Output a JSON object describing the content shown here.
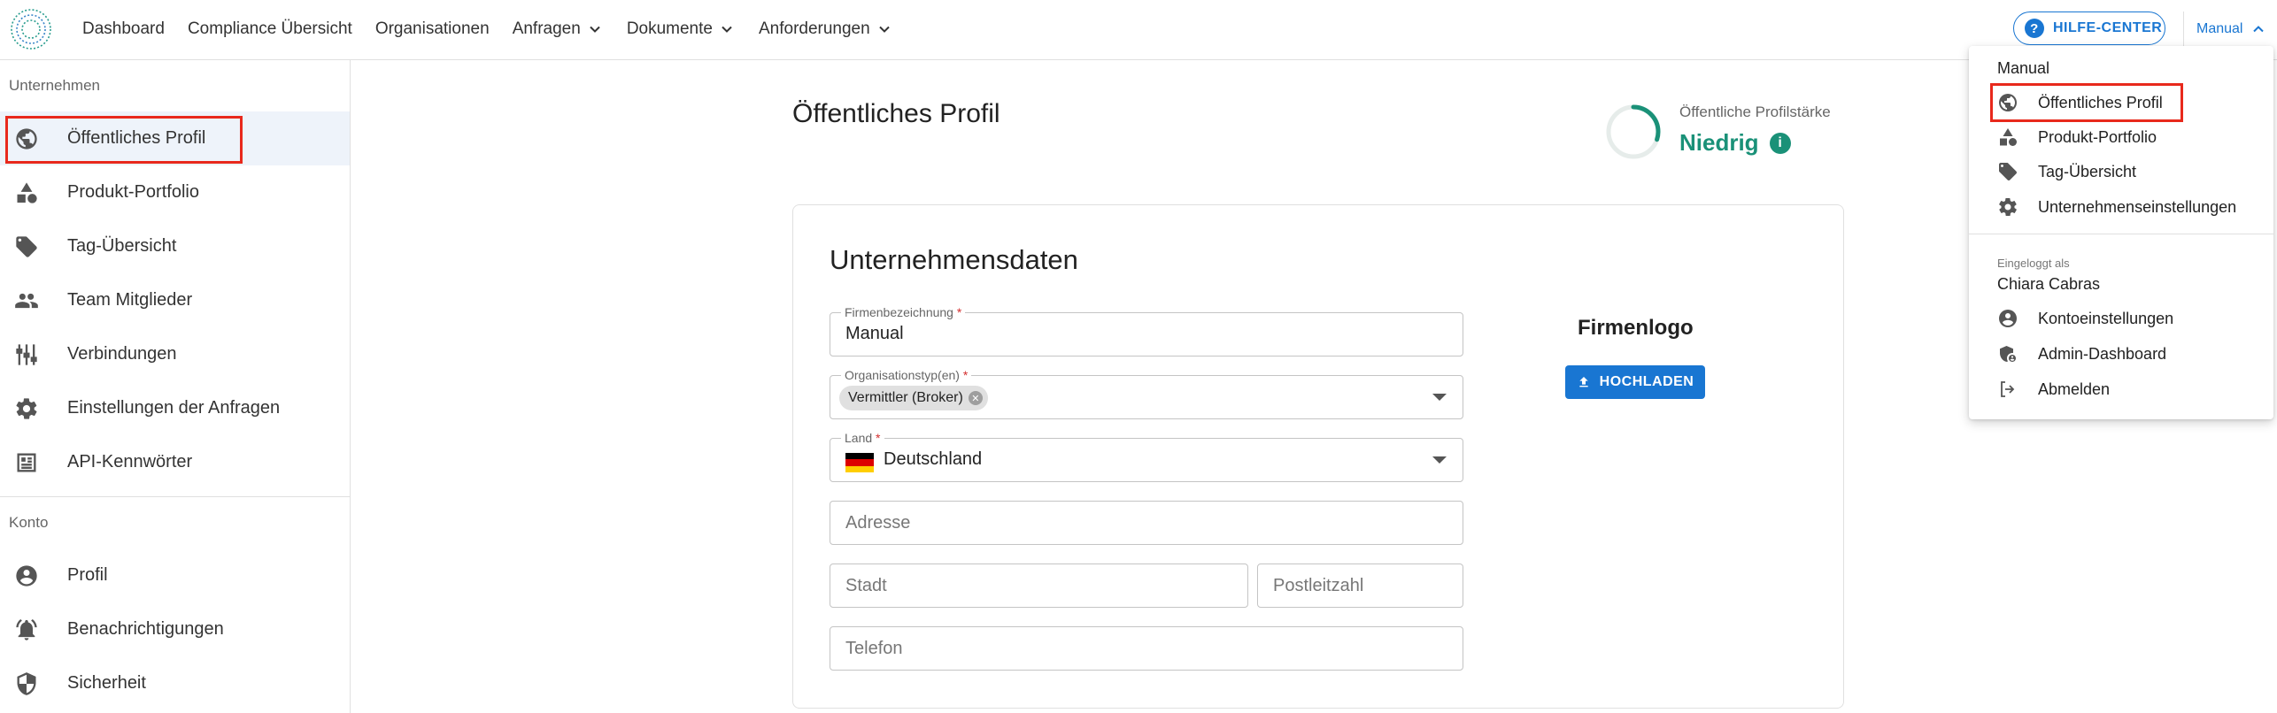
{
  "topnav": {
    "items": [
      {
        "label": "Dashboard",
        "has_chevron": false
      },
      {
        "label": "Compliance Übersicht",
        "has_chevron": false
      },
      {
        "label": "Organisationen",
        "has_chevron": false
      },
      {
        "label": "Anfragen",
        "has_chevron": true
      },
      {
        "label": "Dokumente",
        "has_chevron": true
      },
      {
        "label": "Anforderungen",
        "has_chevron": true
      }
    ],
    "help_label": "HILFE-CENTER",
    "account_label": "Manual"
  },
  "sidebar": {
    "section_company": "Unternehmen",
    "company_items": [
      {
        "label": "Öffentliches Profil",
        "icon": "globe-icon",
        "active": true
      },
      {
        "label": "Produkt-Portfolio",
        "icon": "shapes-icon"
      },
      {
        "label": "Tag-Übersicht",
        "icon": "tag-icon"
      },
      {
        "label": "Team Mitglieder",
        "icon": "people-icon"
      },
      {
        "label": "Verbindungen",
        "icon": "connections-icon"
      },
      {
        "label": "Einstellungen der Anfragen",
        "icon": "gear-icon"
      },
      {
        "label": "API-Kennwörter",
        "icon": "api-icon"
      }
    ],
    "section_account": "Konto",
    "account_items": [
      {
        "label": "Profil",
        "icon": "user-circle-icon"
      },
      {
        "label": "Benachrichtigungen",
        "icon": "bell-icon"
      },
      {
        "label": "Sicherheit",
        "icon": "shield-icon"
      }
    ]
  },
  "main": {
    "page_title": "Öffentliches Profil",
    "strength_label": "Öffentliche Profilstärke",
    "strength_value": "Niedrig",
    "strength_fraction": 0.3,
    "card_title": "Unternehmensdaten",
    "fields": {
      "company_name_label": "Firmenbezeichnung",
      "company_name_value": "Manual",
      "org_type_label": "Organisationstyp(en)",
      "org_type_chip": "Vermittler (Broker)",
      "country_label": "Land",
      "country_value": "Deutschland",
      "address_placeholder": "Adresse",
      "city_placeholder": "Stadt",
      "zip_placeholder": "Postleitzahl",
      "phone_placeholder": "Telefon"
    },
    "logo_title": "Firmenlogo",
    "upload_label": "HOCHLADEN"
  },
  "menu": {
    "header": "Manual",
    "company_items": [
      {
        "label": "Öffentliches Profil",
        "icon": "globe-icon"
      },
      {
        "label": "Produkt-Portfolio",
        "icon": "shapes-icon"
      },
      {
        "label": "Tag-Übersicht",
        "icon": "tag-icon"
      },
      {
        "label": "Unternehmenseinstellungen",
        "icon": "gear-icon"
      }
    ],
    "logged_in_label": "Eingeloggt als",
    "user_name": "Chiara Cabras",
    "user_items": [
      {
        "label": "Kontoeinstellungen",
        "icon": "user-circle-icon"
      },
      {
        "label": "Admin-Dashboard",
        "icon": "admin-shield-icon"
      },
      {
        "label": "Abmelden",
        "icon": "logout-icon"
      }
    ]
  },
  "colors": {
    "accent": "#1976d2",
    "strength": "#1a9178",
    "highlight_border": "#e8291c"
  }
}
